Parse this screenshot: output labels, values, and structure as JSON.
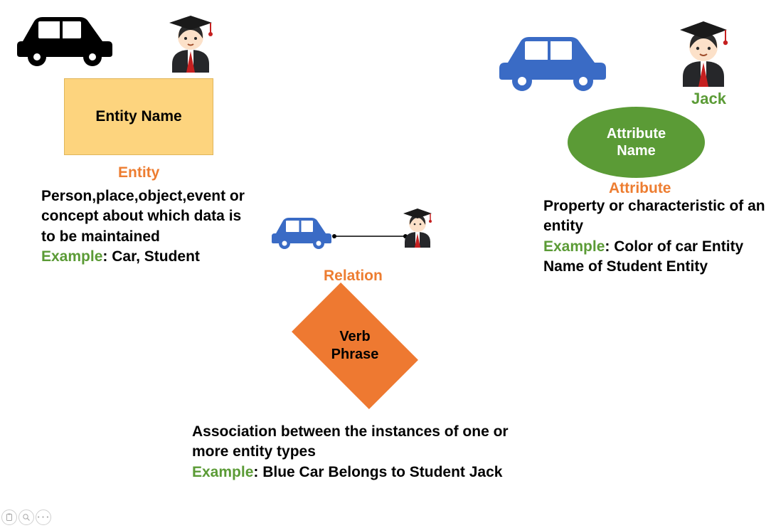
{
  "entity": {
    "shape_label": "Entity Name",
    "heading": "Entity",
    "description": "Person,place,object,event or concept about which data is to be maintained",
    "example_label": "Example",
    "example_text": ": Car, Student"
  },
  "attribute": {
    "jack_label": "Jack",
    "shape_label": "Attribute Name",
    "heading": "Attribute",
    "description": "Property or characteristic of an entity",
    "example_label": "Example",
    "example_text": ": Color of car Entity Name of Student Entity"
  },
  "relation": {
    "heading": "Relation",
    "shape_label": "Verb Phrase",
    "description": "Association between the instances of one or more entity types",
    "example_label": "Example",
    "example_text": ": Blue Car Belongs to Student Jack"
  },
  "icons": {
    "car_black": "car-icon",
    "car_blue": "car-icon",
    "student": "student-icon",
    "clipboard": "clipboard-icon",
    "magnifier": "magnifier-icon",
    "more": "more-icon"
  }
}
